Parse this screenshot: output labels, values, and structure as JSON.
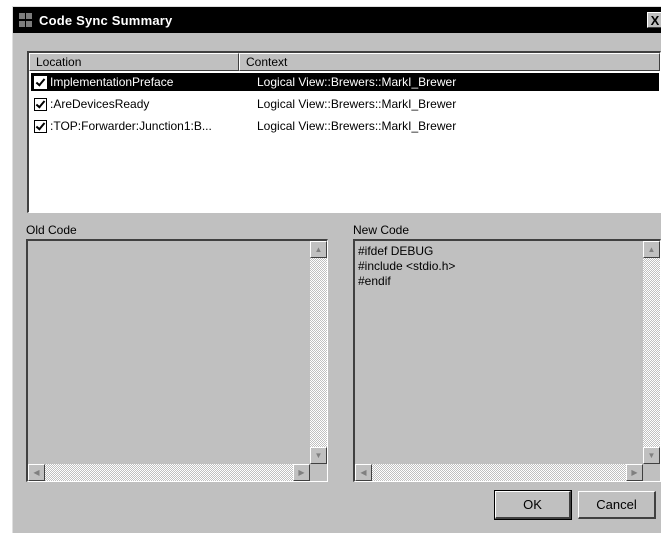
{
  "window": {
    "title": "Code Sync Summary",
    "close_label": "X"
  },
  "list": {
    "columns": [
      "Location",
      "Context"
    ],
    "rows": [
      {
        "checked": true,
        "location": "ImplementationPreface",
        "context": "Logical View::Brewers::MarkI_Brewer",
        "selected": true
      },
      {
        "checked": true,
        "location": ":AreDevicesReady",
        "context": "Logical View::Brewers::MarkI_Brewer",
        "selected": false
      },
      {
        "checked": true,
        "location": ":TOP:Forwarder:Junction1:B...",
        "context": "Logical View::Brewers::MarkI_Brewer",
        "selected": false
      }
    ]
  },
  "old_code": {
    "label": "Old Code",
    "text": ""
  },
  "new_code": {
    "label": "New Code",
    "text": "#ifdef DEBUG\n#include <stdio.h>\n#endif"
  },
  "buttons": {
    "ok": "OK",
    "cancel": "Cancel"
  },
  "icons": {
    "up": "scroll-up-arrow-icon",
    "down": "scroll-down-arrow-icon",
    "left": "scroll-left-arrow-icon",
    "right": "scroll-right-arrow-icon"
  }
}
